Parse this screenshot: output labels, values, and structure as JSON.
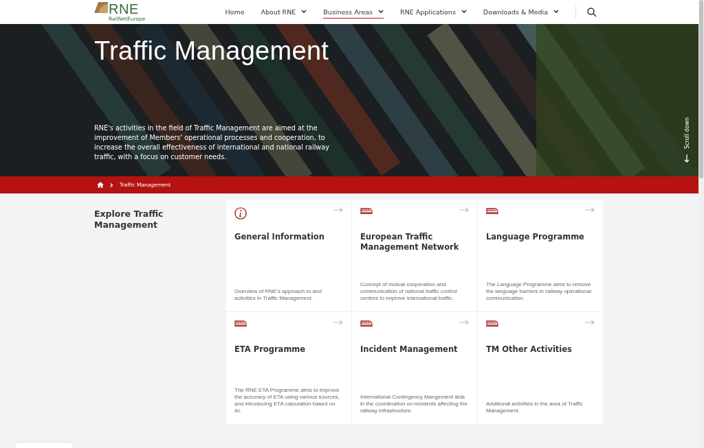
{
  "logo": {
    "mark": "RNE",
    "subtitle": "RailNetEurope"
  },
  "nav": [
    {
      "label": "Home",
      "dropdown": false,
      "selected": false
    },
    {
      "label": "About RNE",
      "dropdown": true,
      "selected": false
    },
    {
      "label": "Business Areas",
      "dropdown": true,
      "selected": true
    },
    {
      "label": "RNE Applications",
      "dropdown": true,
      "selected": false
    },
    {
      "label": "Downloads & Media",
      "dropdown": true,
      "selected": false
    }
  ],
  "hero": {
    "title": "Traffic Management",
    "intro": "RNE's activities in the field of Traffic Management are aimed at the improvement of Members' operational processes and cooperation, to increase the overall effectiveness of international and national railway traffic, with a focus on customer needs.",
    "scroll_label": "Scroll down"
  },
  "breadcrumb": [
    "Traffic Management"
  ],
  "section_title": "Explore Traffic Management",
  "cards": [
    {
      "kind": "info",
      "title": "General Information",
      "text": "Overview of RNE's approach to and activities in Traffic Management."
    },
    {
      "kind": "train",
      "title": "European Traffic Management Network",
      "text": "Concept of mutual cooperation and communication of national traffic control centres to improve international traffic."
    },
    {
      "kind": "train",
      "title": "Language Programme",
      "text": "The Language Programme aims to remove the language barriers in railway operational communication."
    },
    {
      "kind": "train",
      "title": "ETA Programme",
      "text": "The RNE ETA Programme aims to improve the accuracy of ETA using various sources, and introducing ETA calculation based on AI."
    },
    {
      "kind": "train",
      "title": "Incident Management",
      "text": "International Contingency Mangement aids in the coordination on incidents affecting the railway infrastructure."
    },
    {
      "kind": "train",
      "title": "TM Other Activities",
      "text": "Additional activities in the area of Traffic Management."
    }
  ]
}
